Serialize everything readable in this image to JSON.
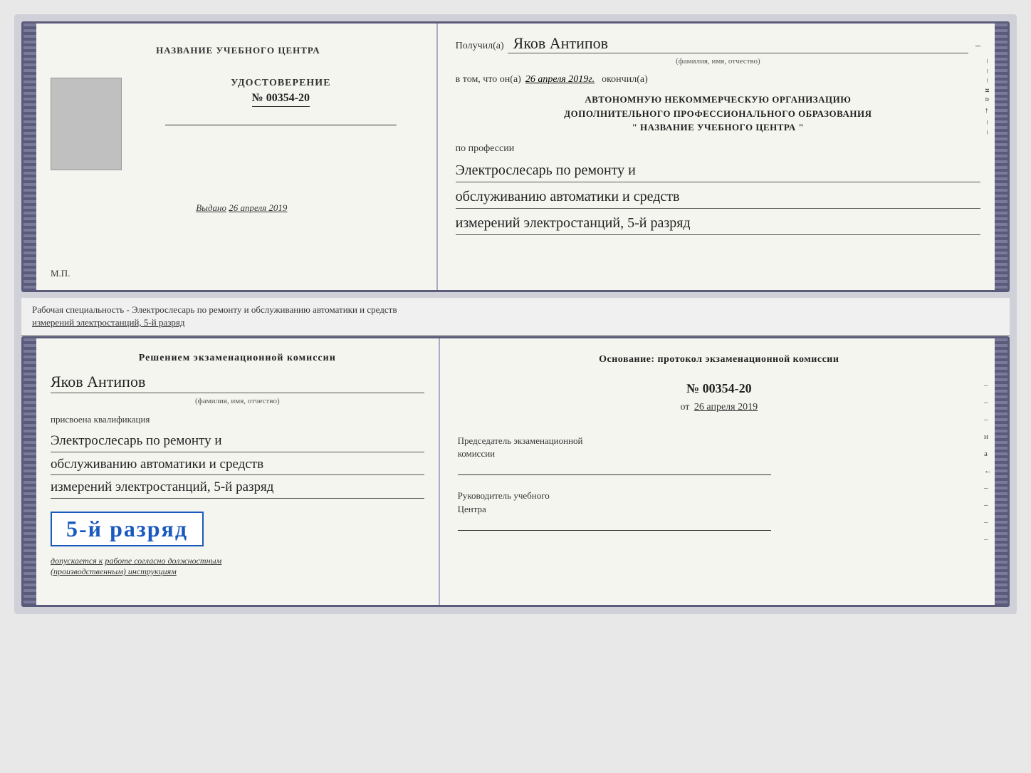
{
  "doc_top": {
    "left": {
      "school_name": "НАЗВАНИЕ УЧЕБНОГО ЦЕНТРА",
      "udostoverenie_label": "УДОСТОВЕРЕНИЕ",
      "cert_number": "№ 00354-20",
      "issued_label": "Выдано",
      "issued_date": "26 апреля 2019",
      "mp_label": "М.П."
    },
    "right": {
      "recipient_prefix": "Получил(а)",
      "recipient_name": "Яков Антипов",
      "fio_caption": "(фамилия, имя, отчество)",
      "certified_prefix": "в том, что он(а)",
      "certified_date": "26 апреля 2019г.",
      "certified_suffix": "окончил(а)",
      "org_line1": "АВТОНОМНУЮ НЕКОММЕРЧЕСКУЮ ОРГАНИЗАЦИЮ",
      "org_line2": "ДОПОЛНИТЕЛЬНОГО ПРОФЕССИОНАЛЬНОГО ОБРАЗОВАНИЯ",
      "org_line3": "\" НАЗВАНИЕ УЧЕБНОГО ЦЕНТРА \"",
      "po_professii": "по профессии",
      "profession_line1": "Электрослесарь по ремонту и",
      "profession_line2": "обслуживанию автоматики и средств",
      "profession_line3": "измерений электростанций, 5-й разряд",
      "side_marks": [
        "–",
        "–",
        "–",
        "и",
        "а",
        "←",
        "–",
        "–",
        "–",
        "–"
      ]
    }
  },
  "info_bar": {
    "text": "Рабочая специальность - Электрослесарь по ремонту и обслуживанию автоматики и средств",
    "text2": "измерений электростанций, 5-й разряд"
  },
  "doc_bottom": {
    "left": {
      "komissia_header": "Решением экзаменационной комиссии",
      "person_name": "Яков Антипов",
      "fio_caption": "(фамилия, имя, отчество)",
      "prisvoena": "присвоена квалификация",
      "qual_line1": "Электрослесарь по ремонту и",
      "qual_line2": "обслуживанию автоматики и средств",
      "qual_line3": "измерений электростанций, 5-й разряд",
      "razryad_label": "5-й разряд",
      "dopuskaetsya_prefix": "допускается к",
      "dopuskaetsya_text": "работе согласно должностным",
      "dopuskaetsya_text2": "(производственным) инструкциям"
    },
    "right": {
      "osnovanie_header": "Основание: протокол экзаменационной комиссии",
      "protocol_number": "№ 00354-20",
      "ot_label": "от",
      "date": "26 апреля 2019",
      "predsedatel_label": "Председатель экзаменационной",
      "komissia_label": "комиссии",
      "rukovoditel_label": "Руководитель учебного",
      "centra_label": "Центра",
      "side_marks": [
        "–",
        "–",
        "–",
        "и",
        "а",
        "←",
        "–",
        "–",
        "–",
        "–"
      ]
    }
  }
}
